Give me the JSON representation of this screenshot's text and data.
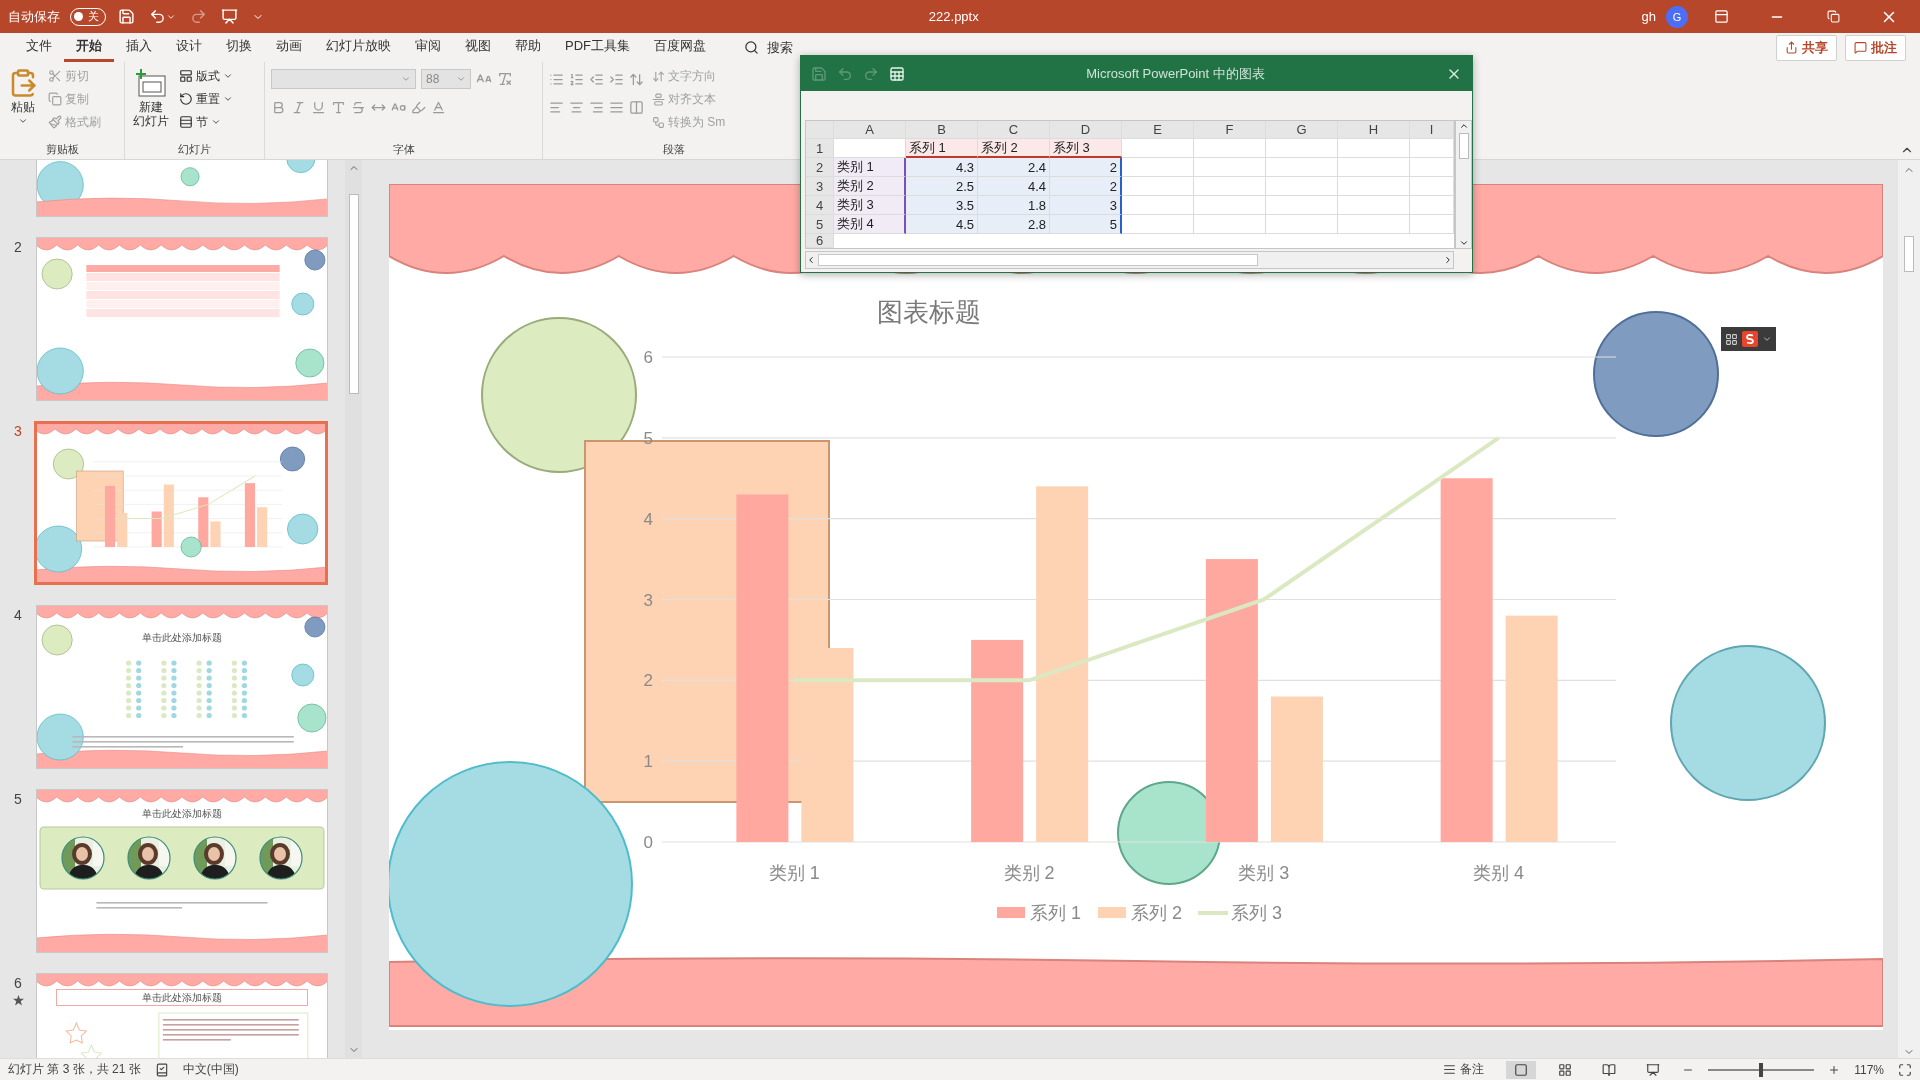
{
  "title_bar": {
    "autosave_label": "自动保存",
    "autosave_toggle": {
      "label": "关",
      "on": false
    },
    "filename": "222.pptx",
    "user": "gh",
    "avatar": "G"
  },
  "menu_tabs": [
    {
      "label": "文件",
      "selected": false
    },
    {
      "label": "开始",
      "selected": true
    },
    {
      "label": "插入",
      "selected": false
    },
    {
      "label": "设计",
      "selected": false
    },
    {
      "label": "切换",
      "selected": false
    },
    {
      "label": "动画",
      "selected": false
    },
    {
      "label": "幻灯片放映",
      "selected": false
    },
    {
      "label": "审阅",
      "selected": false
    },
    {
      "label": "视图",
      "selected": false
    },
    {
      "label": "帮助",
      "selected": false
    },
    {
      "label": "PDF工具集",
      "selected": false
    },
    {
      "label": "百度网盘",
      "selected": false
    }
  ],
  "search": {
    "label": "搜索"
  },
  "share_buttons": [
    "共享",
    "批注"
  ],
  "ribbon": {
    "clipboard": {
      "label": "剪贴板",
      "paste": "粘贴",
      "tools": [
        {
          "label": "剪切",
          "disabled": true
        },
        {
          "label": "复制",
          "disabled": true
        },
        {
          "label": "格式刷",
          "disabled": true
        }
      ]
    },
    "slides": {
      "label": "幻灯片",
      "new_slide": [
        "新建",
        "幻灯片"
      ],
      "tools": [
        "版式",
        "重置",
        "节"
      ]
    },
    "font": {
      "label": "字体",
      "size": "88",
      "disabled": true
    },
    "paragraph": {
      "label": "段落",
      "tools": [
        {
          "label": "文字方向",
          "disabled": true
        },
        {
          "label": "对齐文本",
          "disabled": true
        },
        {
          "label": "转换为 Sm",
          "disabled": true
        }
      ]
    }
  },
  "thumbnails": [
    {
      "kind": "plain",
      "selected": false
    },
    {
      "number": "2",
      "kind": "table",
      "selected": false
    },
    {
      "number": "3",
      "kind": "chart",
      "selected": true
    },
    {
      "number": "4",
      "kind": "stars",
      "selected": false,
      "title": "单击此处添加标题"
    },
    {
      "number": "5",
      "kind": "photos",
      "selected": false,
      "title": "单击此处添加标题"
    },
    {
      "number": "6",
      "kind": "text",
      "selected": false,
      "animated": true,
      "title": "单击此处添加标题"
    }
  ],
  "excel": {
    "title": "Microsoft PowerPoint 中的图表",
    "columns": [
      "A",
      "B",
      "C",
      "D",
      "E",
      "F",
      "G",
      "H",
      "I"
    ],
    "header_row": {
      "number": "1",
      "cells": [
        "系列 1",
        "系列 2",
        "系列 3"
      ]
    },
    "rows": [
      {
        "number": "2",
        "label": "类别 1",
        "values": [
          "4.3",
          "2.4",
          "2"
        ]
      },
      {
        "number": "3",
        "label": "类别 2",
        "values": [
          "2.5",
          "4.4",
          "2"
        ]
      },
      {
        "number": "4",
        "label": "类别 3",
        "values": [
          "3.5",
          "1.8",
          "3"
        ]
      },
      {
        "number": "5",
        "label": "类别 4",
        "values": [
          "4.5",
          "2.8",
          "5"
        ]
      }
    ],
    "last_row": "6"
  },
  "slide": {
    "chart_data": {
      "type": "bar",
      "title": "图表标题",
      "categories": [
        "类别 1",
        "类别 2",
        "类别 3",
        "类别 4"
      ],
      "series": [
        {
          "name": "系列 1",
          "color": "#ffa8a0",
          "type": "bar",
          "values": [
            4.3,
            2.5,
            3.5,
            4.5
          ]
        },
        {
          "name": "系列 2",
          "color": "#fdd3b3",
          "type": "bar",
          "values": [
            2.4,
            4.4,
            1.8,
            2.8
          ]
        },
        {
          "name": "系列 3",
          "color": "#dbe9c2",
          "type": "line",
          "values": [
            2,
            2,
            3,
            5
          ]
        }
      ],
      "ylim": [
        0,
        6
      ],
      "yticks": [
        0,
        1,
        2,
        3,
        4,
        5,
        6
      ],
      "grid": true,
      "legend": true
    }
  },
  "status_bar": {
    "slide_info": "幻灯片 第 3 张，共 21 张",
    "language": "中文(中国)",
    "notes": "备注",
    "zoom": "117%",
    "zoom_slider": {
      "level": 0.5
    }
  }
}
